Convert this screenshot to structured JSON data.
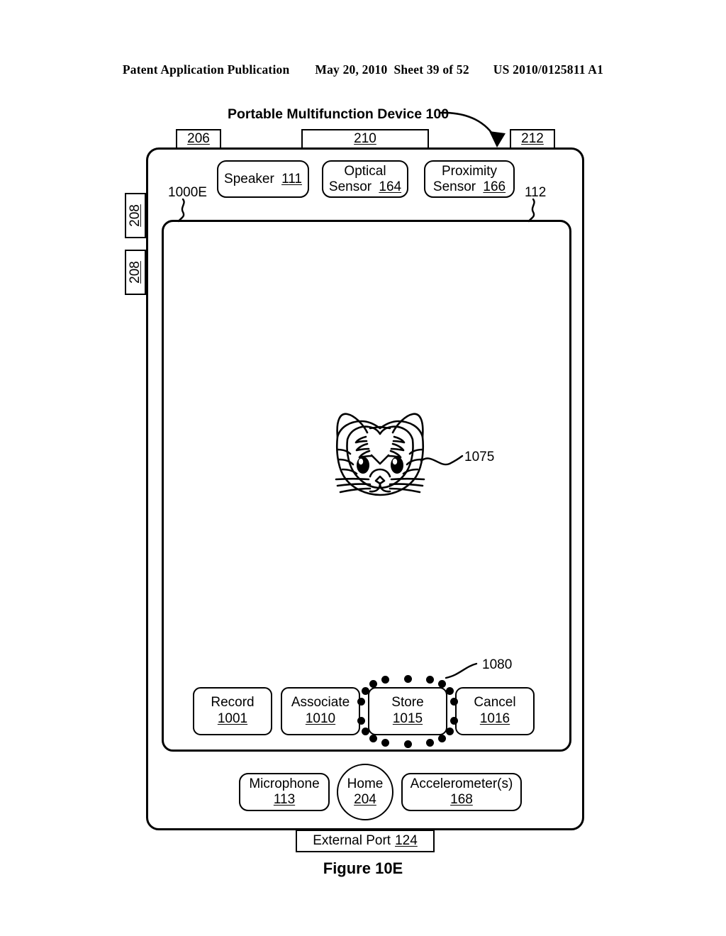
{
  "page_header": {
    "publication": "Patent Application Publication",
    "date": "May 20, 2010",
    "sheet": "Sheet 39 of 52",
    "patent_number": "US 2010/0125811 A1"
  },
  "figure": {
    "caption": "Figure 10E",
    "device_title": "Portable Multifunction Device 100",
    "ui_state_label": "1000E",
    "touchscreen_label": "112"
  },
  "top_tabs": [
    {
      "name": "tab-206",
      "label": "206"
    },
    {
      "name": "tab-210",
      "label": "210"
    },
    {
      "name": "tab-212",
      "label": "212"
    }
  ],
  "side_buttons": [
    {
      "name": "side-button-208-upper",
      "label": "208"
    },
    {
      "name": "side-button-208-lower",
      "label": "208"
    }
  ],
  "sensors": [
    {
      "name": "speaker",
      "line1": "Speaker",
      "ref": "111",
      "inline": true
    },
    {
      "name": "optical-sensor",
      "line1": "Optical",
      "line2": "Sensor",
      "ref": "164",
      "inline": false
    },
    {
      "name": "proximity-sensor",
      "line1": "Proximity",
      "line2": "Sensor",
      "ref": "166",
      "inline": false
    }
  ],
  "screen_content": {
    "avatar_label": "1075",
    "avatar_icon": "tiger-face-icon",
    "selection_highlight_label": "1080"
  },
  "action_buttons": [
    {
      "name": "record-button",
      "label": "Record",
      "ref": "1001",
      "selected": false
    },
    {
      "name": "associate-button",
      "label": "Associate",
      "ref": "1010",
      "selected": false
    },
    {
      "name": "store-button",
      "label": "Store",
      "ref": "1015",
      "selected": true
    },
    {
      "name": "cancel-button",
      "label": "Cancel",
      "ref": "1016",
      "selected": false
    }
  ],
  "bottom_components": [
    {
      "name": "microphone",
      "label": "Microphone",
      "ref": "113"
    },
    {
      "name": "home-button",
      "label": "Home",
      "ref": "204"
    },
    {
      "name": "accelerometers",
      "label": "Accelerometer(s)",
      "ref": "168"
    }
  ],
  "external_port": {
    "label": "External Port",
    "ref": "124"
  },
  "colors": {
    "ink": "#000000",
    "paper": "#ffffff"
  }
}
